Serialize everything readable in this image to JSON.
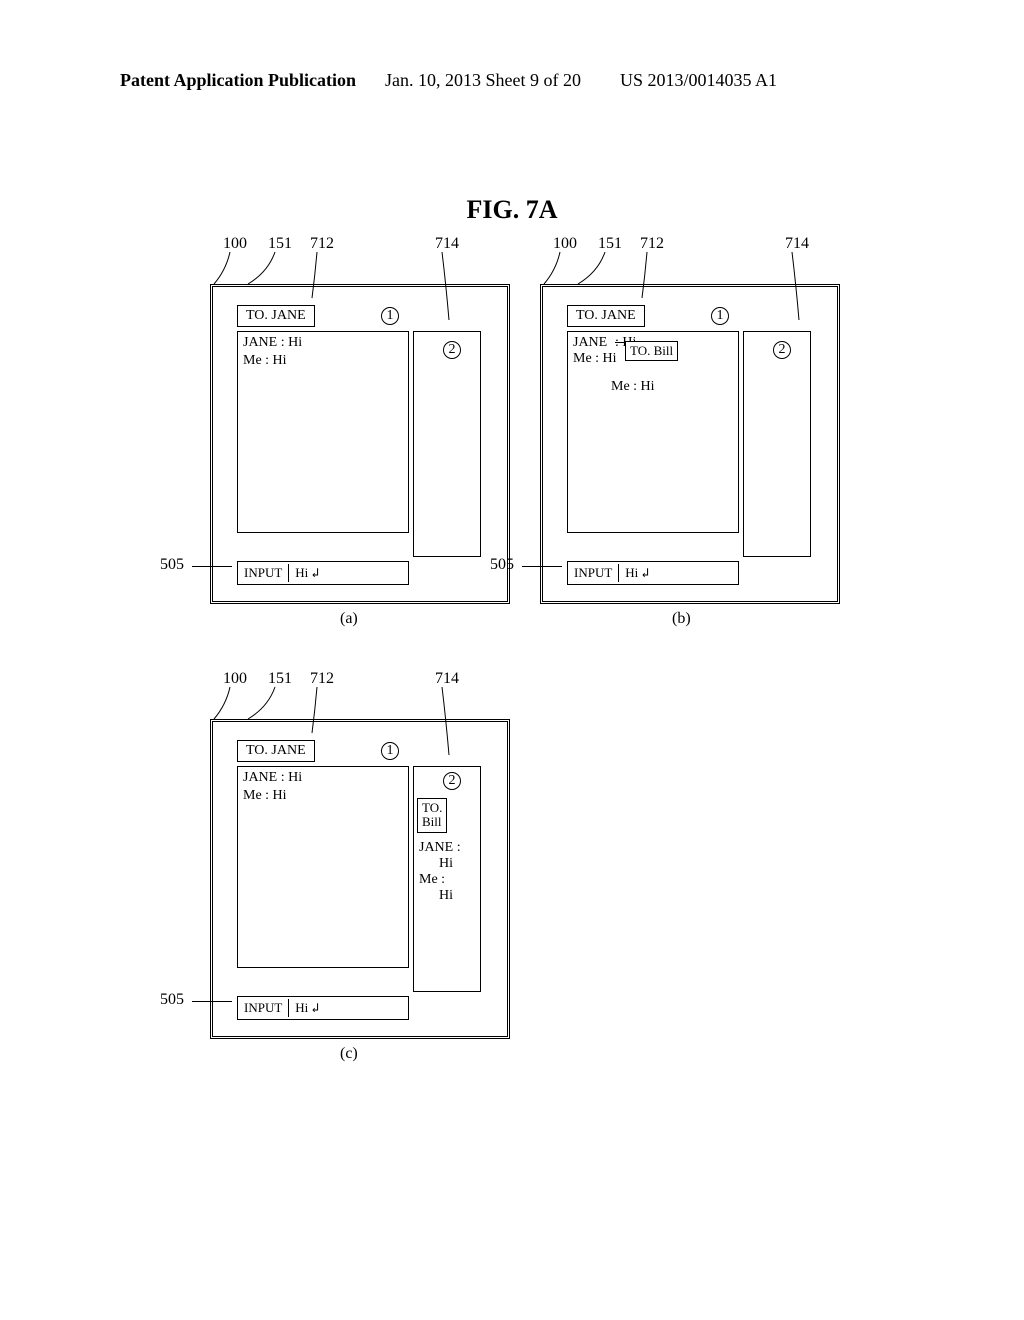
{
  "header": {
    "left": "Patent Application Publication",
    "mid": "Jan. 10, 2013  Sheet 9 of 20",
    "right": "US 2013/0014035 A1"
  },
  "figure_title": "FIG. 7A",
  "refs": {
    "r100": "100",
    "r151": "151",
    "r712": "712",
    "r714": "714",
    "r505": "505"
  },
  "circled": {
    "one": "1",
    "two": "2"
  },
  "recipient_jane": "TO. JANE",
  "recipient_bill_inline": "TO. Bill",
  "recipient_bill_stack": "TO.\nBill",
  "panelA": {
    "line1": "JANE : Hi",
    "line2": "Me : Hi"
  },
  "panelB": {
    "line1a": "JANE",
    "line1b": ": Hi",
    "line2": "Me : Hi",
    "line3": "Me : Hi"
  },
  "panelC": {
    "left_line1": "JANE : Hi",
    "left_line2": "Me : Hi",
    "right_line1": "JANE :",
    "right_line1b": "Hi",
    "right_line2": "Me :",
    "right_line2b": "Hi"
  },
  "input": {
    "label": "INPUT",
    "text": "Hi",
    "enter": "↲"
  },
  "sublabels": {
    "a": "(a)",
    "b": "(b)",
    "c": "(c)"
  }
}
